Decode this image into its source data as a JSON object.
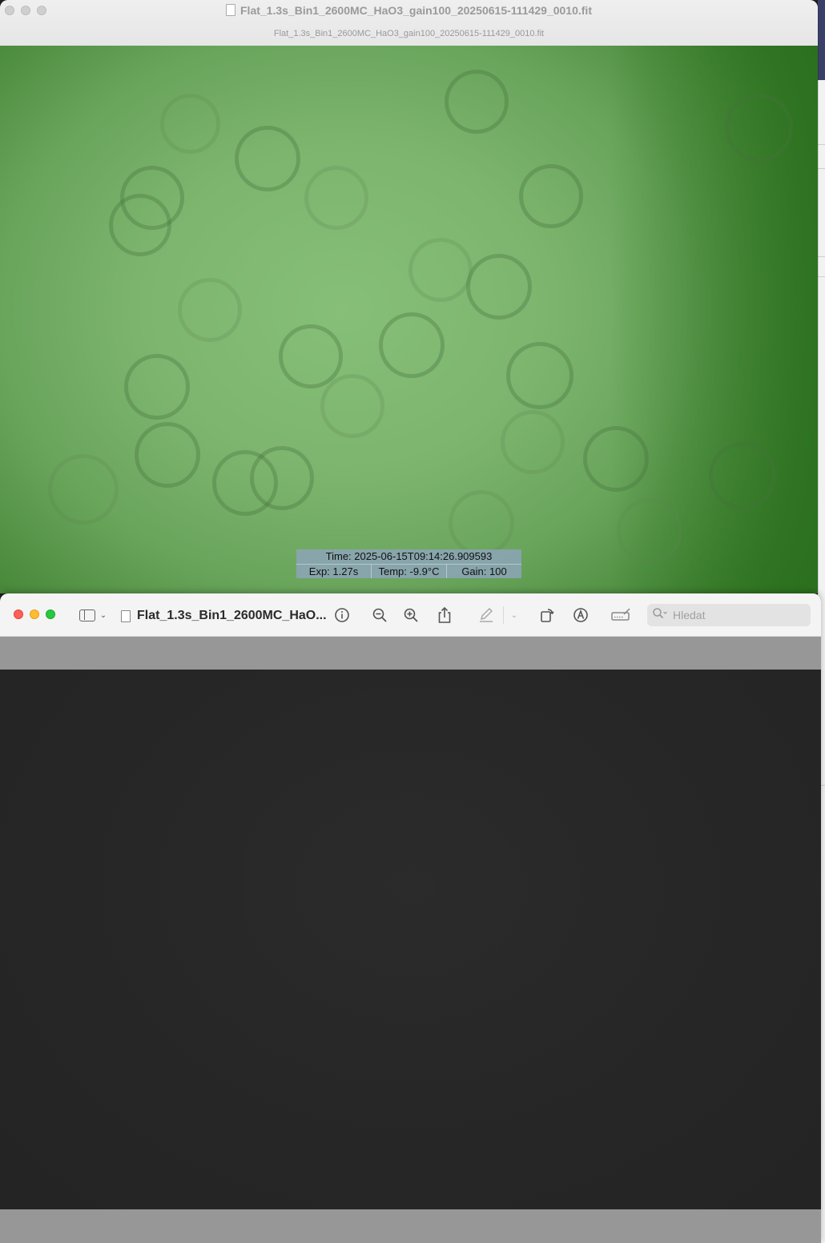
{
  "window_top": {
    "title": "Flat_1.3s_Bin1_2600MC_HaO3_gain100_20250615-111429_0010.fit",
    "subtitle": "Flat_1.3s_Bin1_2600MC_HaO3_gain100_20250615-111429_0010.fit",
    "overlay": {
      "time": "Time: 2025-06-15T09:14:26.909593",
      "exp": "Exp: 1.27s",
      "temp": "Temp: -9.9°C",
      "gain": "Gain: 100"
    }
  },
  "window_preview": {
    "doc_title": "Flat_1.3s_Bin1_2600MC_HaO...",
    "search_placeholder": "Hledat",
    "icons": [
      "sidebar-icon",
      "chevron-down-icon",
      "document-icon",
      "info-icon",
      "zoom-out-icon",
      "zoom-in-icon",
      "share-icon",
      "markup-pen-icon",
      "chevron-down-icon",
      "rotate-icon",
      "annotate-icon",
      "signature-icon",
      "search-icon"
    ]
  },
  "colors": {
    "flat_green": "#7db56f",
    "flat_edge_green": "#2f7422",
    "preview_dark": "#262626",
    "band_gray": "#979797",
    "close": "#fe5f57",
    "minimize": "#febc2e",
    "zoom": "#28c840"
  }
}
